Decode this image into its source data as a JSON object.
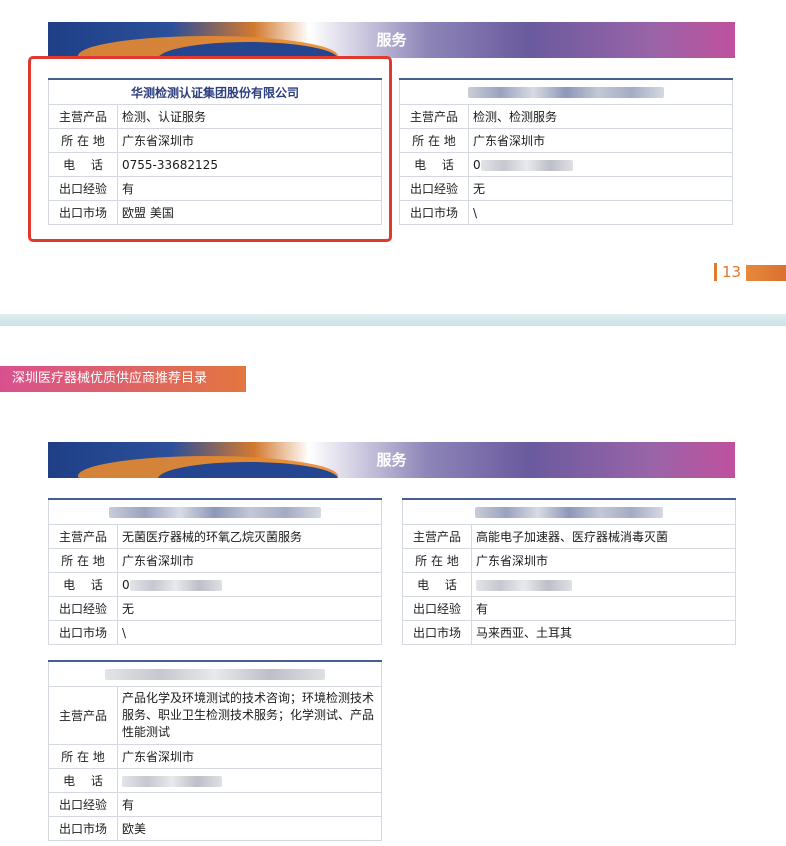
{
  "banner_title": "服务",
  "page_number": "13",
  "catalog_tag": "深圳医疗器械优质供应商推荐目录",
  "labels": {
    "product": "主营产品",
    "location": "所 在 地",
    "phone": "电　 话",
    "export_exp": "出口经验",
    "export_market": "出口市场"
  },
  "cards": [
    {
      "name": "华测检测认证集团股份有限公司",
      "product": "检测、认证服务",
      "location": "广东省深圳市",
      "phone": "0755-33682125",
      "export_exp": "有",
      "export_market": "欧盟 美国"
    },
    {
      "name": "",
      "product": "检测、检测服务",
      "location": "广东省深圳市",
      "phone": "0",
      "export_exp": "无",
      "export_market": "\\"
    },
    {
      "name": "",
      "product": "无菌医疗器械的环氧乙烷灭菌服务",
      "location": "广东省深圳市",
      "phone": "0",
      "export_exp": "无",
      "export_market": "\\"
    },
    {
      "name": "",
      "product": "高能电子加速器、医疗器械消毒灭菌",
      "location": "广东省深圳市",
      "phone": "",
      "export_exp": "有",
      "export_market": "马来西亚、土耳其"
    },
    {
      "name": "",
      "product": "产品化学及环境测试的技术咨询；环境检测技术服务、职业卫生检测技术服务；化学测试、产品性能测试",
      "location": "广东省深圳市",
      "phone": "",
      "export_exp": "有",
      "export_market": "欧美"
    }
  ],
  "colors": {
    "highlight_box": "#e03a2f",
    "header_text": "#2e3f7f",
    "accent_orange": "#e2792f"
  }
}
